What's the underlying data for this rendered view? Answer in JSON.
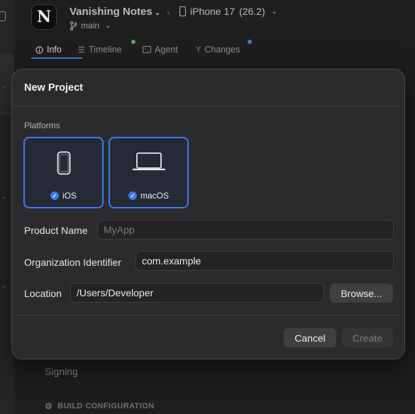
{
  "toolbar": {
    "app_icon_letter": "N",
    "project_name": "Vanishing Notes",
    "branch": "main",
    "device": "iPhone 17",
    "os_version": "(26.2)"
  },
  "tabs": [
    {
      "label": "Info",
      "icon": "info-circle-icon"
    },
    {
      "label": "Timeline",
      "icon": "list-icon"
    },
    {
      "label": "Agent",
      "icon": "terminal-icon"
    },
    {
      "label": "Changes",
      "icon": "branch-merge-icon"
    }
  ],
  "background": {
    "signing": "Signing",
    "build_configuration": "BUILD CONFIGURATION"
  },
  "modal": {
    "title": "New Project",
    "platforms_label": "Platforms",
    "platforms": [
      {
        "label": "iOS",
        "icon": "iphone-icon",
        "selected": true
      },
      {
        "label": "macOS",
        "icon": "laptop-icon",
        "selected": true
      }
    ],
    "product_name": {
      "label": "Product Name",
      "value": "",
      "placeholder": "MyApp"
    },
    "org_identifier": {
      "label": "Organization Identifier",
      "value": "com.example"
    },
    "location": {
      "label": "Location",
      "value": "/Users/Developer"
    },
    "browse_label": "Browse...",
    "cancel_label": "Cancel",
    "create_label": "Create"
  },
  "colors": {
    "accent": "#3b7cf0",
    "status_green": "#4caf50",
    "status_blue": "#3a7be0"
  }
}
